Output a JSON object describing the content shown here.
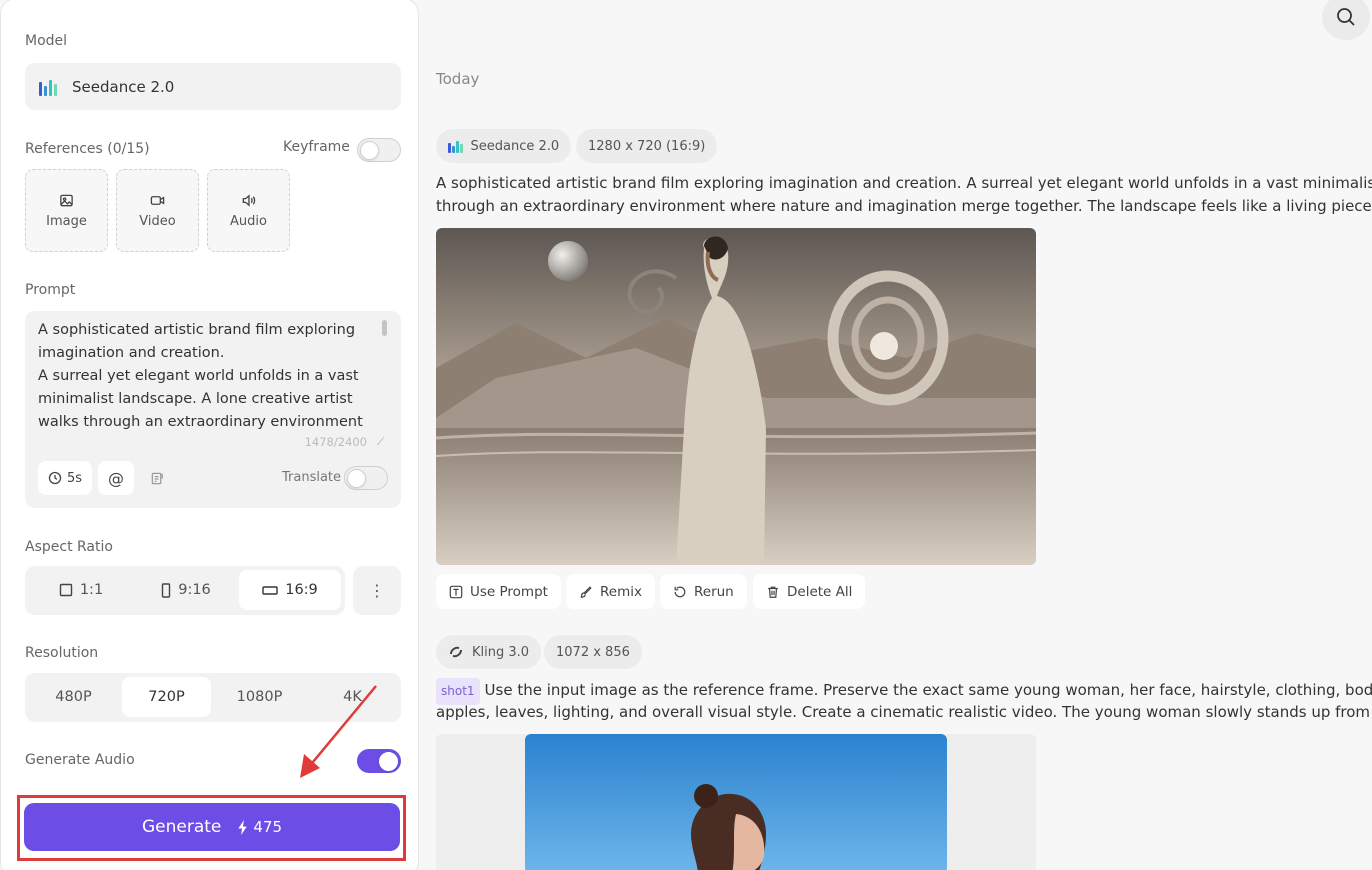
{
  "sidebar": {
    "model_label": "Model",
    "model_name": "Seedance 2.0",
    "references_label": "References (0/15)",
    "keyframe_label": "Keyframe",
    "ref_buttons": [
      "Image",
      "Video",
      "Audio"
    ],
    "prompt_label": "Prompt",
    "prompt_text": "A sophisticated artistic brand film exploring imagination and creation.\nA surreal yet elegant world unfolds in a vast minimalist landscape. A lone creative artist walks through an extraordinary environment",
    "prompt_counter": "1478/2400",
    "duration_chip": "5s",
    "mention_chip": "@",
    "translate_label": "Translate",
    "aspect_ratio_label": "Aspect Ratio",
    "aspect_options": [
      "1:1",
      "9:16",
      "16:9"
    ],
    "aspect_selected": "16:9",
    "resolution_label": "Resolution",
    "resolution_options": [
      "480P",
      "720P",
      "1080P",
      "4K"
    ],
    "resolution_selected": "720P",
    "generate_audio_label": "Generate Audio",
    "generate_label": "Generate",
    "generate_credits": "475",
    "toggles": {
      "keyframe": false,
      "translate": false,
      "generate_audio": true
    }
  },
  "feed": {
    "section_title": "Today",
    "items": [
      {
        "model": "Seedance 2.0",
        "dims": "1280 x 720 (16:9)",
        "prompt_line1": "A sophisticated artistic brand film exploring imagination and creation. A surreal yet elegant world unfolds in a vast minimalist landscape",
        "prompt_line2": "through an extraordinary environment where nature and imagination merge together. The landscape feels like a living piece of contemporary art",
        "actions": [
          "Use Prompt",
          "Remix",
          "Rerun",
          "Delete All"
        ]
      },
      {
        "model": "Kling 3.0",
        "dims": "1072 x 856",
        "shot_tag": "shot1",
        "prompt_line1": "Use the input image as the reference frame. Preserve the exact same young woman, her face, hairstyle, clothing, body proportions",
        "prompt_line2": "apples, leaves, lighting, and overall visual style. Create a cinematic realistic video. The young woman slowly stands up from the moment"
      }
    ]
  },
  "colors": {
    "accent": "#6c4de6",
    "highlight_box": "#e03a3a",
    "panel_bg": "#f2f2f2"
  },
  "icons": [
    "search-icon",
    "image-icon",
    "video-icon",
    "audio-icon",
    "clock-icon",
    "at-icon",
    "notes-icon",
    "square-icon",
    "portrait-icon",
    "landscape-icon",
    "more-vertical-icon",
    "bolt-icon",
    "text-box-icon",
    "brush-icon",
    "refresh-icon",
    "trash-icon"
  ]
}
